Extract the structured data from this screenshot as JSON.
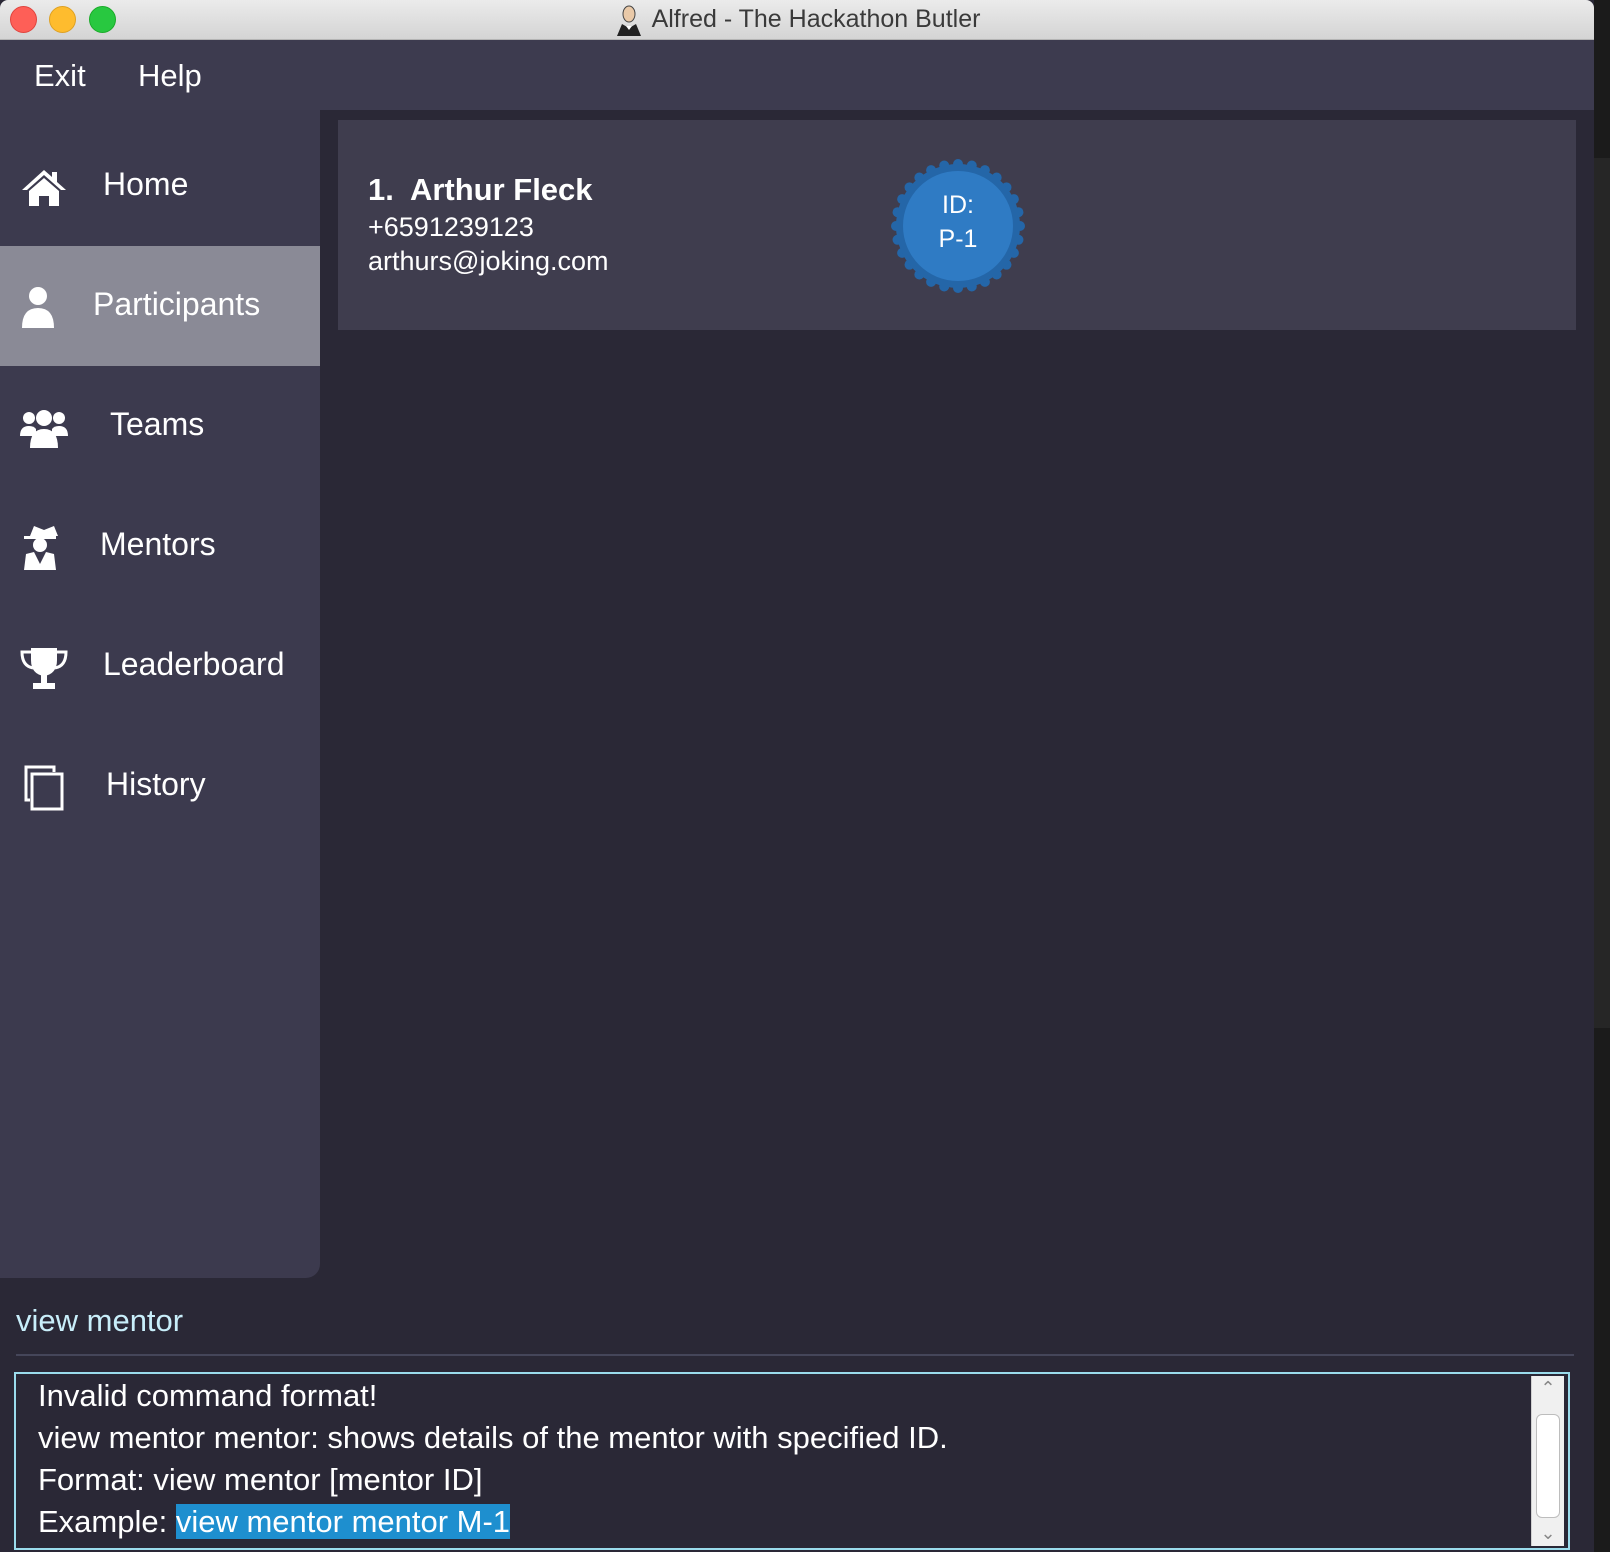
{
  "window": {
    "title": "Alfred - The Hackathon Butler"
  },
  "menubar": {
    "items": [
      "Exit",
      "Help"
    ]
  },
  "sidebar": {
    "items": [
      {
        "label": "Home",
        "icon": "home-icon"
      },
      {
        "label": "Participants",
        "icon": "person-icon",
        "active": true
      },
      {
        "label": "Teams",
        "icon": "group-icon"
      },
      {
        "label": "Mentors",
        "icon": "spy-icon"
      },
      {
        "label": "Leaderboard",
        "icon": "trophy-icon"
      },
      {
        "label": "History",
        "icon": "copy-icon"
      }
    ]
  },
  "participant_card": {
    "index": "1.",
    "name": "Arthur Fleck",
    "phone": "+6591239123",
    "email": "arthurs@joking.com",
    "id_label": "ID:",
    "id_value": "P-1"
  },
  "command": {
    "input_value": "view mentor"
  },
  "result": {
    "lines": [
      "Invalid command format!",
      "view mentor mentor: shows details of the mentor with specified ID.",
      "Format: view mentor [mentor ID]"
    ],
    "example_prefix": "Example: ",
    "example_highlight": "view mentor mentor M-1"
  },
  "colors": {
    "background": "#2a2836",
    "sidebar": "#3c3a4e",
    "active_item": "#8a8a96",
    "badge": "#2f7bc4",
    "highlight": "#1e8fcf",
    "result_border": "#9bdcec"
  }
}
